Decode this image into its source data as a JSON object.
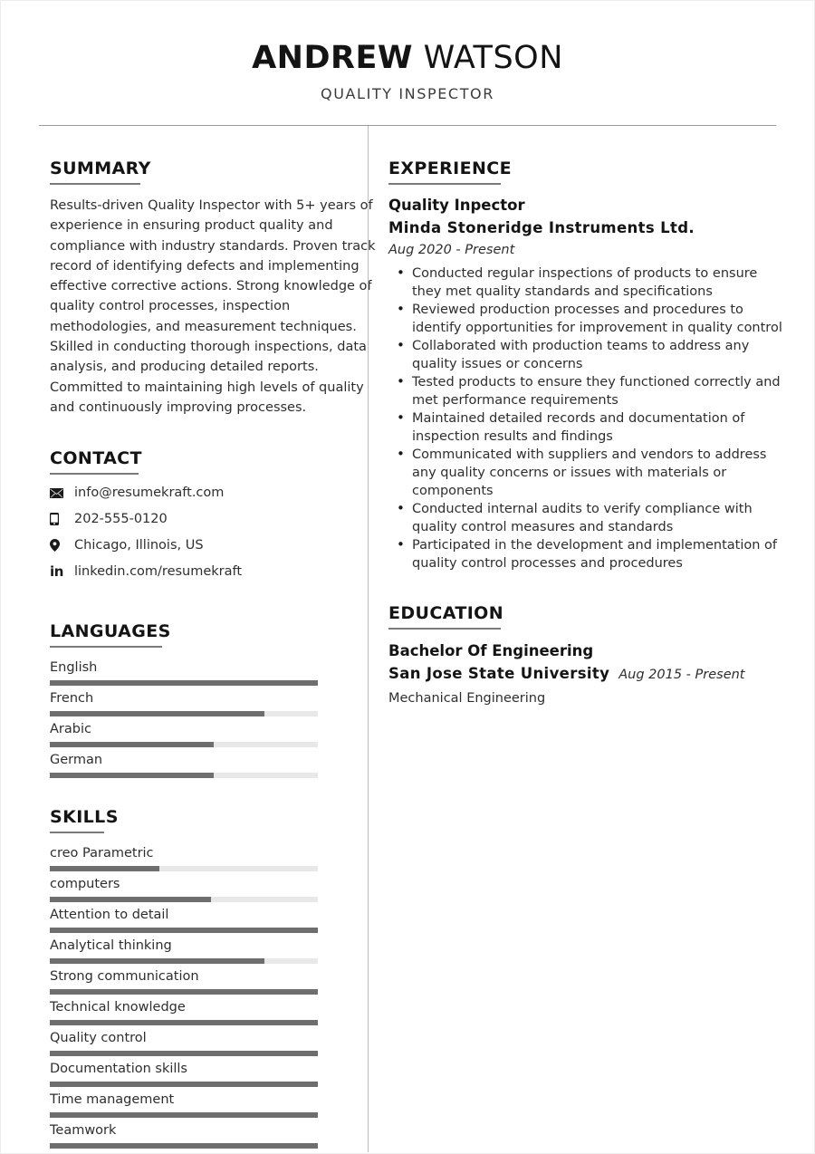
{
  "header": {
    "first_name": "ANDREW",
    "last_name": "WATSON",
    "job_title": "QUALITY INSPECTOR"
  },
  "summary": {
    "heading": "SUMMARY",
    "text": "Results-driven Quality Inspector with 5+ years of experience in ensuring product quality and compliance with industry standards. Proven track record of identifying defects and implementing effective corrective actions. Strong knowledge of quality control processes, inspection methodologies, and measurement techniques. Skilled in conducting thorough inspections, data analysis, and producing detailed reports. Committed to maintaining high levels of quality and continuously improving processes."
  },
  "contact": {
    "heading": "CONTACT",
    "items": [
      {
        "icon": "envelope-icon",
        "value": "info@resumekraft.com"
      },
      {
        "icon": "phone-icon",
        "value": "202-555-0120"
      },
      {
        "icon": "location-pin-icon",
        "value": "Chicago, Illinois, US"
      },
      {
        "icon": "linkedin-icon",
        "value": "linkedin.com/resumekraft"
      }
    ]
  },
  "languages": {
    "heading": "LANGUAGES",
    "items": [
      {
        "label": "English",
        "level": 100
      },
      {
        "label": "French",
        "level": 80
      },
      {
        "label": "Arabic",
        "level": 61
      },
      {
        "label": "German",
        "level": 61
      }
    ]
  },
  "skills": {
    "heading": "SKILLS",
    "items": [
      {
        "label": "creo Parametric",
        "level": 41
      },
      {
        "label": "computers",
        "level": 60
      },
      {
        "label": "Attention to detail",
        "level": 100
      },
      {
        "label": "Analytical thinking",
        "level": 80
      },
      {
        "label": "Strong communication",
        "level": 100
      },
      {
        "label": "Technical knowledge",
        "level": 100
      },
      {
        "label": "Quality control",
        "level": 100
      },
      {
        "label": "Documentation skills",
        "level": 100
      },
      {
        "label": "Time management",
        "level": 100
      },
      {
        "label": "Teamwork",
        "level": 100
      }
    ]
  },
  "experience": {
    "heading": "EXPERIENCE",
    "entries": [
      {
        "title": "Quality Inpector",
        "company": "Minda Stoneridge Instruments Ltd.",
        "dates": "Aug 2020 - Present",
        "bullets": [
          "Conducted regular inspections of products to ensure they met quality standards and specifications",
          "Reviewed production processes and procedures to identify opportunities for improvement in quality control",
          "Collaborated with production teams to address any quality issues or concerns",
          "Tested products to ensure they functioned correctly and met performance requirements",
          "Maintained detailed records and documentation of inspection results and findings",
          "Communicated with suppliers and vendors to address any quality concerns or issues with materials or components",
          "Conducted internal audits to verify compliance with quality control measures and standards",
          "Participated in the development and implementation of quality control processes and procedures"
        ]
      }
    ]
  },
  "education": {
    "heading": "EDUCATION",
    "entries": [
      {
        "degree": "Bachelor Of Engineering",
        "school": "San Jose State University",
        "dates": "Aug 2015 - Present",
        "field": "Mechanical Engineering"
      }
    ]
  },
  "colors": {
    "text": "#2e2e2e",
    "heading": "#141414",
    "bar_fill": "#6e6e6e",
    "bar_track": "#e8e8e8",
    "divider": "#9a9a9a"
  }
}
